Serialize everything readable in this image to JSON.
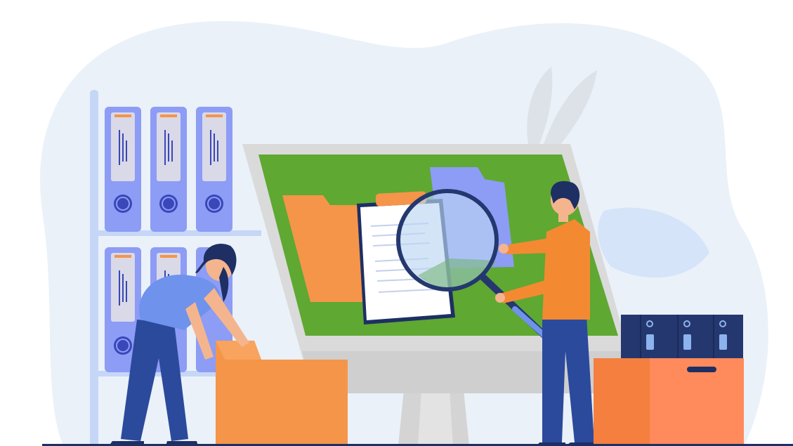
{
  "scene": {
    "kind": "flat-illustration",
    "icons": [
      "binder-icon",
      "monitor-icon",
      "folder-icon",
      "clipboard-icon",
      "magnifier-icon",
      "person-icon",
      "plant-leaf-icon",
      "box-icon"
    ]
  },
  "colors": {
    "blob": "#eaf1f9",
    "binder": "#8d9cf5",
    "binderRing": "#3a47b8",
    "screenGreen": "#5fa832",
    "monitorFrame": "#dadada",
    "folderOrange": "#f4954a",
    "boxSalmon": "#ff8a5c",
    "navy": "#1e2f63",
    "shirtBlue": "#6f92ec",
    "shirtOrange": "#f38a32",
    "pantsBlue": "#2b4a9c",
    "leaf": "#d5e4f8"
  }
}
